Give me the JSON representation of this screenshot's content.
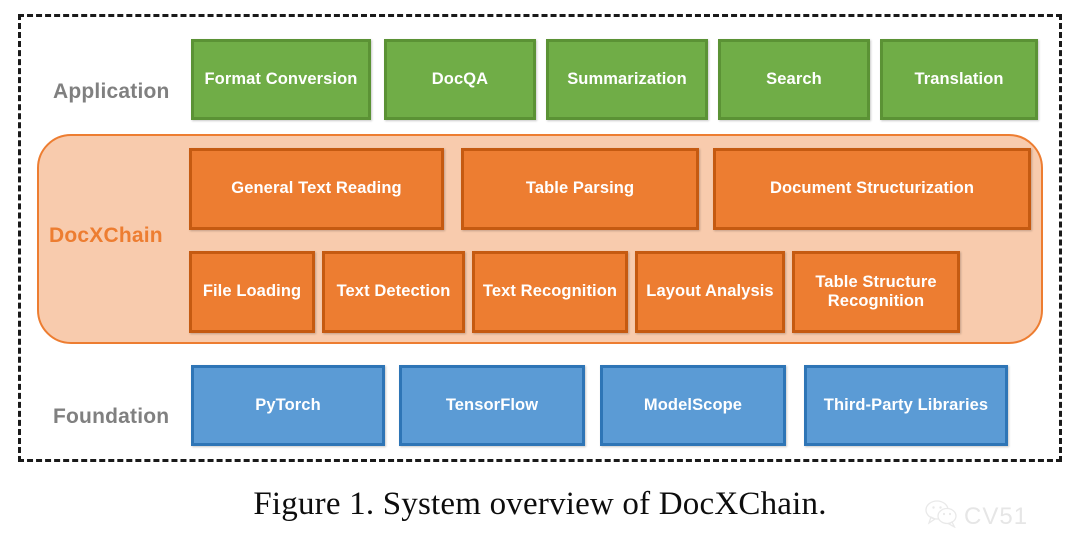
{
  "figure": {
    "caption": "Figure 1. System overview of DocXChain.",
    "watermark_text": "CV51",
    "watermark_icon": "wechat-icon"
  },
  "colors": {
    "application_fill": "#70AD47",
    "application_stroke": "#5B9235",
    "docxchain_fill": "#ED7D31",
    "docxchain_stroke": "#C55A11",
    "docxchain_panel_fill": "#F8CBAD",
    "foundation_fill": "#5B9BD5",
    "foundation_stroke": "#2E75B6",
    "row_label": "#808080",
    "frame_border": "#1A1A1A"
  },
  "layers": {
    "application": {
      "label": "Application",
      "items": [
        {
          "label": "Format Conversion"
        },
        {
          "label": "DocQA"
        },
        {
          "label": "Summarization"
        },
        {
          "label": "Search"
        },
        {
          "label": "Translation"
        }
      ]
    },
    "docxchain": {
      "label": "DocXChain",
      "pipelines": [
        {
          "label": "General Text Reading"
        },
        {
          "label": "Table Parsing"
        },
        {
          "label": "Document Structurization"
        }
      ],
      "capabilities": [
        {
          "label": "File Loading"
        },
        {
          "label": "Text Detection"
        },
        {
          "label": "Text Recognition"
        },
        {
          "label": "Layout Analysis"
        },
        {
          "label": "Table Structure Recognition"
        }
      ]
    },
    "foundation": {
      "label": "Foundation",
      "items": [
        {
          "label": "PyTorch"
        },
        {
          "label": "TensorFlow"
        },
        {
          "label": "ModelScope"
        },
        {
          "label": "Third-Party Libraries"
        }
      ]
    }
  }
}
